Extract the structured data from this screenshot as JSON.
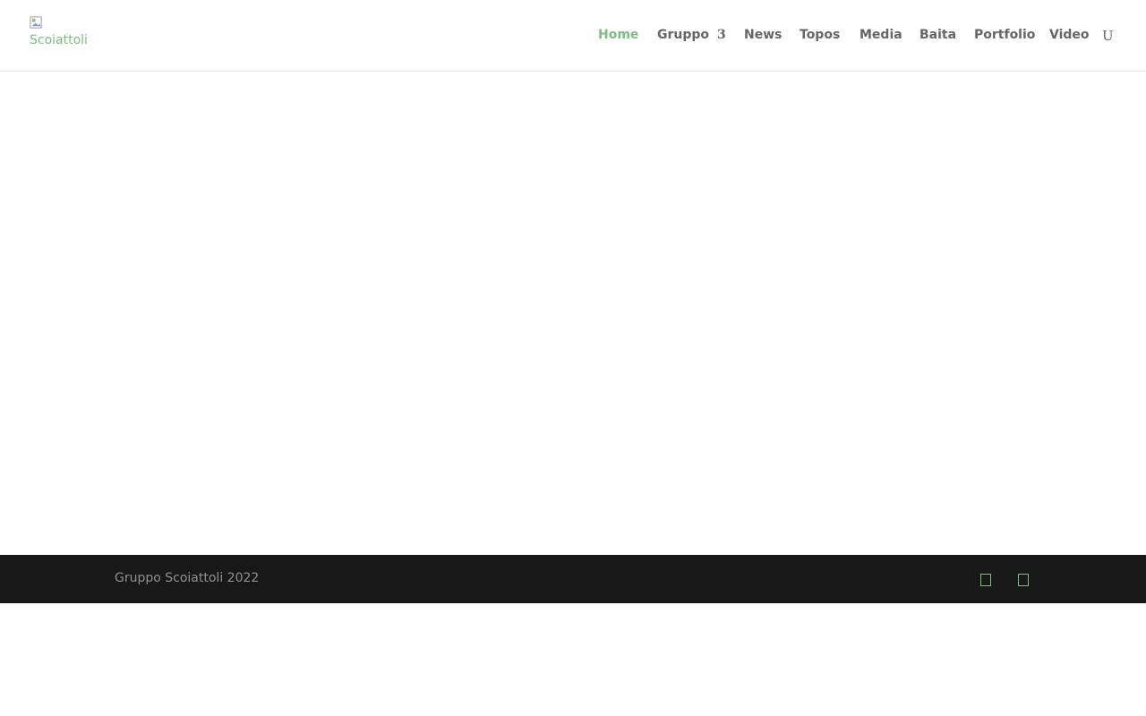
{
  "header": {
    "logo_alt": "Scoiattoli",
    "nav": [
      {
        "label": "Home",
        "active": true
      },
      {
        "label": "Gruppo",
        "has_submenu": true,
        "submenu_icon": "3"
      },
      {
        "label": "News"
      },
      {
        "label": "Topos"
      },
      {
        "label": "Media"
      },
      {
        "label": "Baita"
      },
      {
        "label": "Portfolio"
      },
      {
        "label": "Video"
      }
    ],
    "search_icon_glyph": "U"
  },
  "footer": {
    "copyright": "Gruppo Scoiattoli 2022",
    "social_icons": [
      "social-icon-1",
      "social-icon-2"
    ]
  },
  "colors": {
    "accent": "#7cbf7c",
    "nav_text": "#666666",
    "footer_bg": "#181818",
    "footer_text": "#8f8f8f"
  }
}
